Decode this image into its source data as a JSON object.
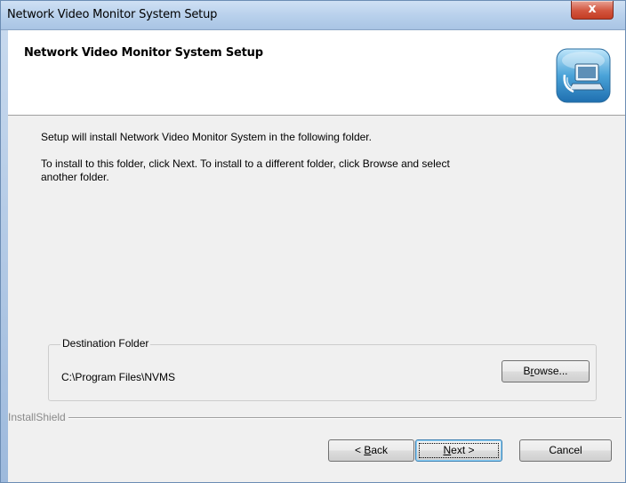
{
  "window": {
    "title": "Network Video Monitor System Setup",
    "close_label": "x"
  },
  "header": {
    "title": "Network Video Monitor System Setup",
    "icon": "setup-computer-icon"
  },
  "body": {
    "line1": "Setup will install Network Video Monitor System in the following folder.",
    "line2": "To install to this folder, click Next. To install to a different folder, click Browse and select",
    "line3": "another folder."
  },
  "destination": {
    "group_label": "Destination Folder",
    "path": "C:\\Program Files\\NVMS",
    "browse_pre": "B",
    "browse_mnemonic": "r",
    "browse_post": "owse..."
  },
  "footer": {
    "installshield_label": "InstallShield",
    "back_pre": "< ",
    "back_mnemonic": "B",
    "back_post": "ack",
    "next_mnemonic": "N",
    "next_post": "ext >",
    "cancel_label": "Cancel"
  }
}
